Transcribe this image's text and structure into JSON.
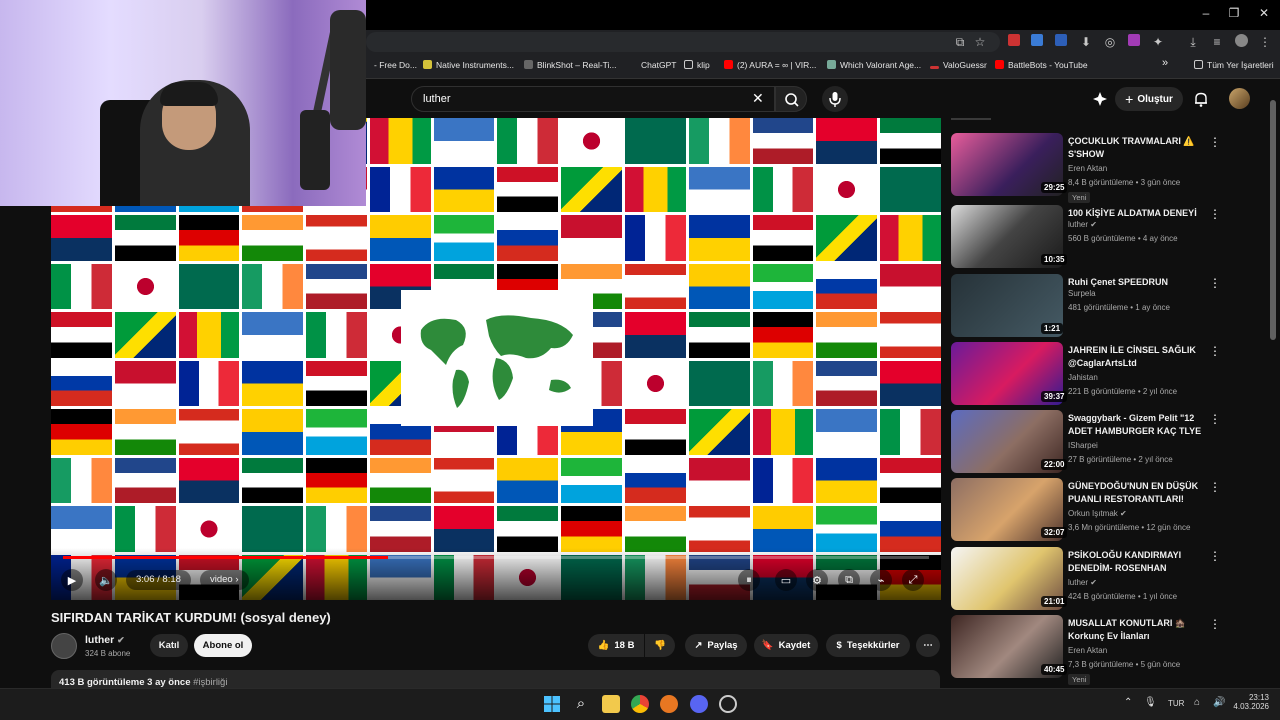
{
  "browser": {
    "bookmarks": [
      {
        "label": "- Free Do..."
      },
      {
        "label": "Native Instruments..."
      },
      {
        "label": "BlinkShot – Real-Ti..."
      },
      {
        "label": "ChatGPT"
      },
      {
        "label": "klip"
      },
      {
        "label": "(2) AURA = ∞ | VIR..."
      },
      {
        "label": "Which Valorant Age..."
      },
      {
        "label": "ValoGuessr"
      },
      {
        "label": "BattleBots - YouTube"
      },
      {
        "label": "Tüm Yer İşaretleri"
      }
    ],
    "more_label": "»"
  },
  "youtube": {
    "search_query": "luther",
    "create_label": "Oluştur"
  },
  "player": {
    "time": "3:06 / 8:18",
    "chapter": "video",
    "progress_fraction": 0.375
  },
  "video": {
    "title": "SIFIRDAN TARİKAT KURDUM! (sosyal deney)",
    "channel": "luther",
    "subscribers": "324 B abone",
    "join_label": "Katıl",
    "subscribe_label": "Abone ol",
    "likes": "18 B",
    "share_label": "Paylaş",
    "save_label": "Kaydet",
    "thanks_label": "Teşekkürler",
    "views": "413 B görüntüleme",
    "date": "3 ay önce",
    "hashtag": "#işbirliği"
  },
  "recommendations": [
    {
      "title": "ÇOCUKLUK TRAVMALARI ⚠️ S'SHOW",
      "channel": "Eren Aktan",
      "meta": "8,4 B görüntüleme • 3 gün önce",
      "duration": "29:25",
      "badge": "Yeni"
    },
    {
      "title": "100 KİŞİYE ALDATMA DENEYİ",
      "channel": "luther ✔",
      "meta": "560 B görüntüleme • 4 ay önce",
      "duration": "10:35",
      "badge": ""
    },
    {
      "title": "Ruhi Çenet SPEEDRUN",
      "channel": "Surpela",
      "meta": "481 görüntüleme • 1 ay önce",
      "duration": "1:21",
      "badge": ""
    },
    {
      "title": "JAHREIN İLE CİNSEL SAĞLIK @CaglarArtsLtd",
      "channel": "Jahistan",
      "meta": "221 B görüntüleme • 2 yıl önce",
      "duration": "39:37",
      "badge": ""
    },
    {
      "title": "Swaggybark - Gizem Pelit \"12 ADET HAMBURGER KAÇ TLYE ...",
      "channel": "ISharpei",
      "meta": "27 B görüntüleme • 2 yıl önce",
      "duration": "22:00",
      "badge": ""
    },
    {
      "title": "GÜNEYDOĞU'NUN EN DÜŞÜK PUANLI RESTORANTLARI!",
      "channel": "Orkun Işıtmak ✔",
      "meta": "3,6 Mn görüntüleme • 12 gün önce",
      "duration": "32:07",
      "badge": ""
    },
    {
      "title": "PSİKOLOĞU KANDIRMAYI DENEDİM- ROSENHAN DENEY...",
      "channel": "luther ✔",
      "meta": "424 B görüntüleme • 1 yıl önce",
      "duration": "21:01",
      "badge": ""
    },
    {
      "title": "MUSALLAT KONUTLARI 🏚️ Korkunç Ev İlanları",
      "channel": "Eren Aktan",
      "meta": "7,3 B görüntüleme • 5 gün önce",
      "duration": "40:45",
      "badge": "Yeni"
    }
  ],
  "taskbar": {
    "language": "TUR",
    "time": "23:13",
    "date": "4.03.2026"
  },
  "colors": {
    "accent": "#ff0000",
    "background": "#0f0f0f"
  }
}
